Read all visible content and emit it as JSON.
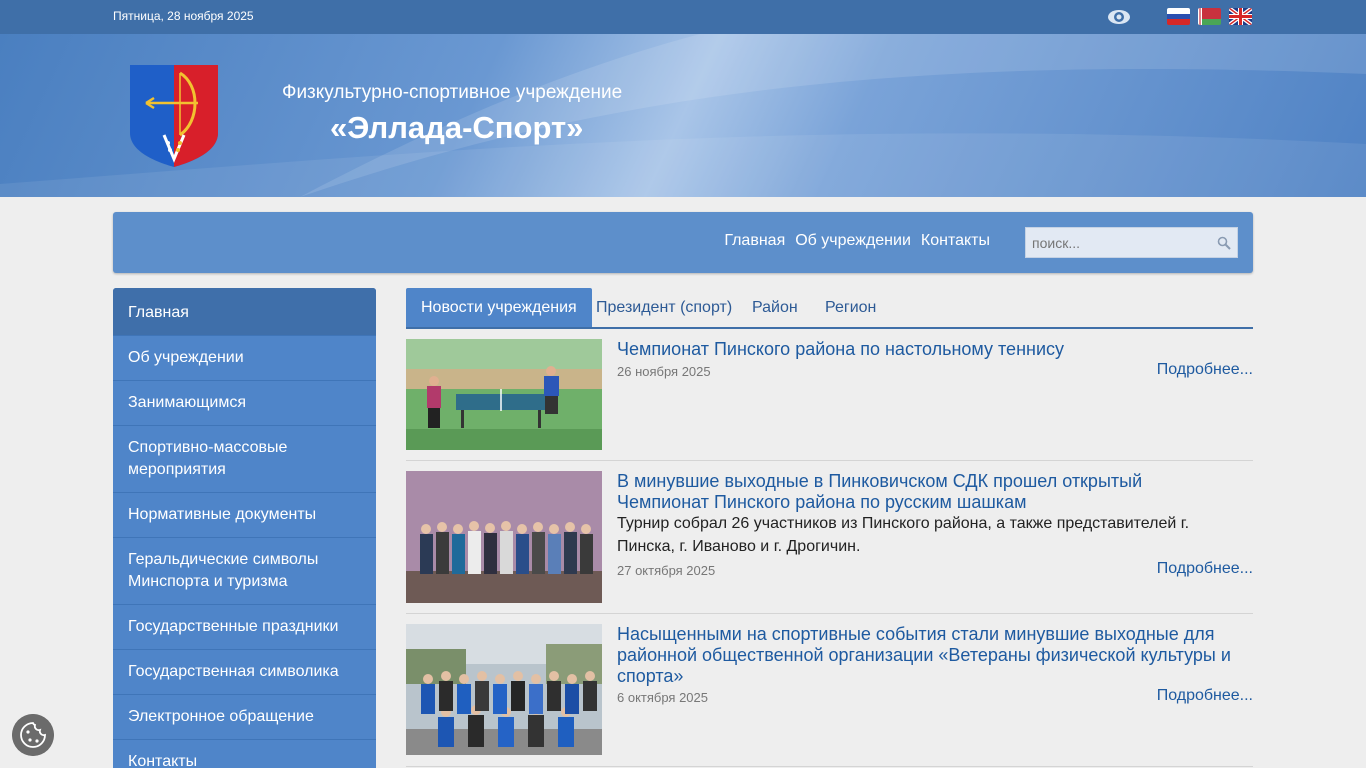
{
  "topbar": {
    "date": "Пятница, 28 ноября 2025",
    "icons": [
      "eye-icon",
      "flag-russia-icon",
      "flag-belarus-icon",
      "flag-uk-icon"
    ]
  },
  "header": {
    "subtitle": "Физкультурно-спортивное учреждение",
    "title": "«Эллада-Спорт»"
  },
  "nav": {
    "links": [
      "Главная",
      "Об учреждении",
      "Контакты"
    ],
    "search_placeholder": "поиск..."
  },
  "sidebar": {
    "items": [
      "Главная",
      "Об учреждении",
      "Занимающимся",
      "Спортивно-массовые мероприятия",
      "Нормативные документы",
      "Геральдические символы Минспорта и туризма",
      "Государственные праздники",
      "Государственная символика",
      "Электронное обращение",
      "Контакты"
    ]
  },
  "tabs": [
    "Новости учреждения",
    "Президент (спорт)",
    "Район",
    "Регион"
  ],
  "news": [
    {
      "title": "Чемпионат Пинского района по настольному теннису",
      "date": "26 ноября 2025",
      "desc": "",
      "more": "Подробнее..."
    },
    {
      "title": "В минувшие выходные в Пинковичском СДК прошел открытый Чемпионат Пинского района по русским шашкам",
      "date": "27 октября 2025",
      "desc": "Турнир собрал 26 участников из Пинского района, а также представителей г. Пинска, г. Иваново и г. Дрогичин.",
      "more": "Подробнее..."
    },
    {
      "title": "Насыщенными на спортивные события стали минувшие выходные для районной общественной организации «Ветераны физической культуры и спорта»",
      "date": "6 октября 2025",
      "desc": "",
      "more": "Подробнее..."
    }
  ],
  "colors": {
    "topbar": "#3f6fa8",
    "nav": "#5d8fcb",
    "sidebar": "#4f85c9",
    "link": "#1e5aa0"
  }
}
